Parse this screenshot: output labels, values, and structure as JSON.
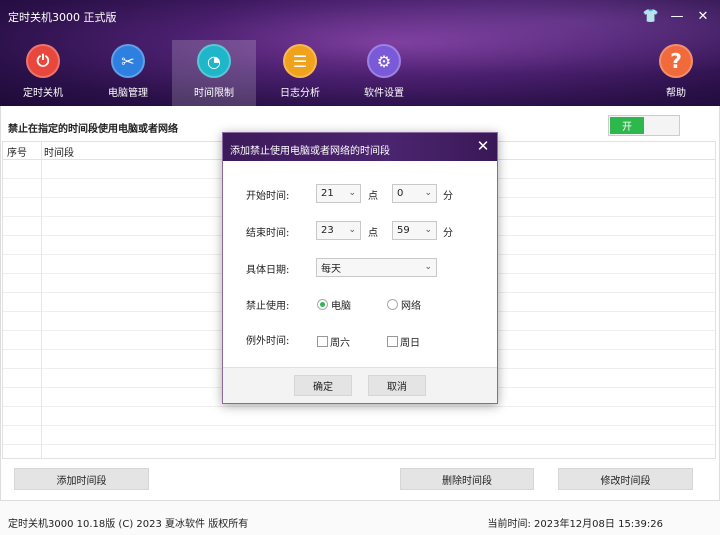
{
  "app": {
    "title": "定时关机3000 正式版"
  },
  "window_controls": {
    "skin": "👕",
    "minimize": "—",
    "close": "✕"
  },
  "nav": {
    "items": [
      {
        "label": "定时关机",
        "icon": "power-icon",
        "glyph": "⏻",
        "color": "#e8473d"
      },
      {
        "label": "电脑管理",
        "icon": "tools-icon",
        "glyph": "✂",
        "color": "#2d7fe0"
      },
      {
        "label": "时间限制",
        "icon": "timer-icon",
        "glyph": "◔",
        "color": "#1fb6c9",
        "active": true
      },
      {
        "label": "日志分析",
        "icon": "log-icon",
        "glyph": "☰",
        "color": "#f0a21c"
      },
      {
        "label": "软件设置",
        "icon": "settings-icon",
        "glyph": "⚙",
        "color": "#7a5ad8"
      },
      {
        "label": "帮助",
        "icon": "help-icon",
        "glyph": "?",
        "color": "#f06a3c"
      }
    ]
  },
  "main": {
    "section_title": "禁止在指定的时间段使用电脑或者网络",
    "toggle_label": "开",
    "table": {
      "headers": [
        "序号",
        "时间段"
      ]
    },
    "buttons": {
      "add": "添加时间段",
      "delete": "删除时间段",
      "modify": "修改时间段"
    }
  },
  "dialog": {
    "title": "添加禁止使用电脑或者网络的时间段",
    "start_label": "开始时间:",
    "start_hour": "21",
    "start_minute": "0",
    "end_label": "结束时间:",
    "end_hour": "23",
    "end_minute": "59",
    "hour_unit": "点",
    "minute_unit": "分",
    "date_label": "具体日期:",
    "date_value": "每天",
    "forbid_label": "禁止使用:",
    "forbid_options": [
      "电脑",
      "网络"
    ],
    "forbid_selected": "电脑",
    "except_label": "例外时间:",
    "except_options": [
      "周六",
      "周日"
    ],
    "ok": "确定",
    "cancel": "取消"
  },
  "footer": {
    "left": "定时关机3000 10.18版 (C) 2023  夏冰软件 版权所有",
    "right": "当前时间:  2023年12月08日 15:39:26"
  },
  "colors": {
    "accent_green": "#2db84c",
    "header_purple": "#4a1f6e"
  }
}
